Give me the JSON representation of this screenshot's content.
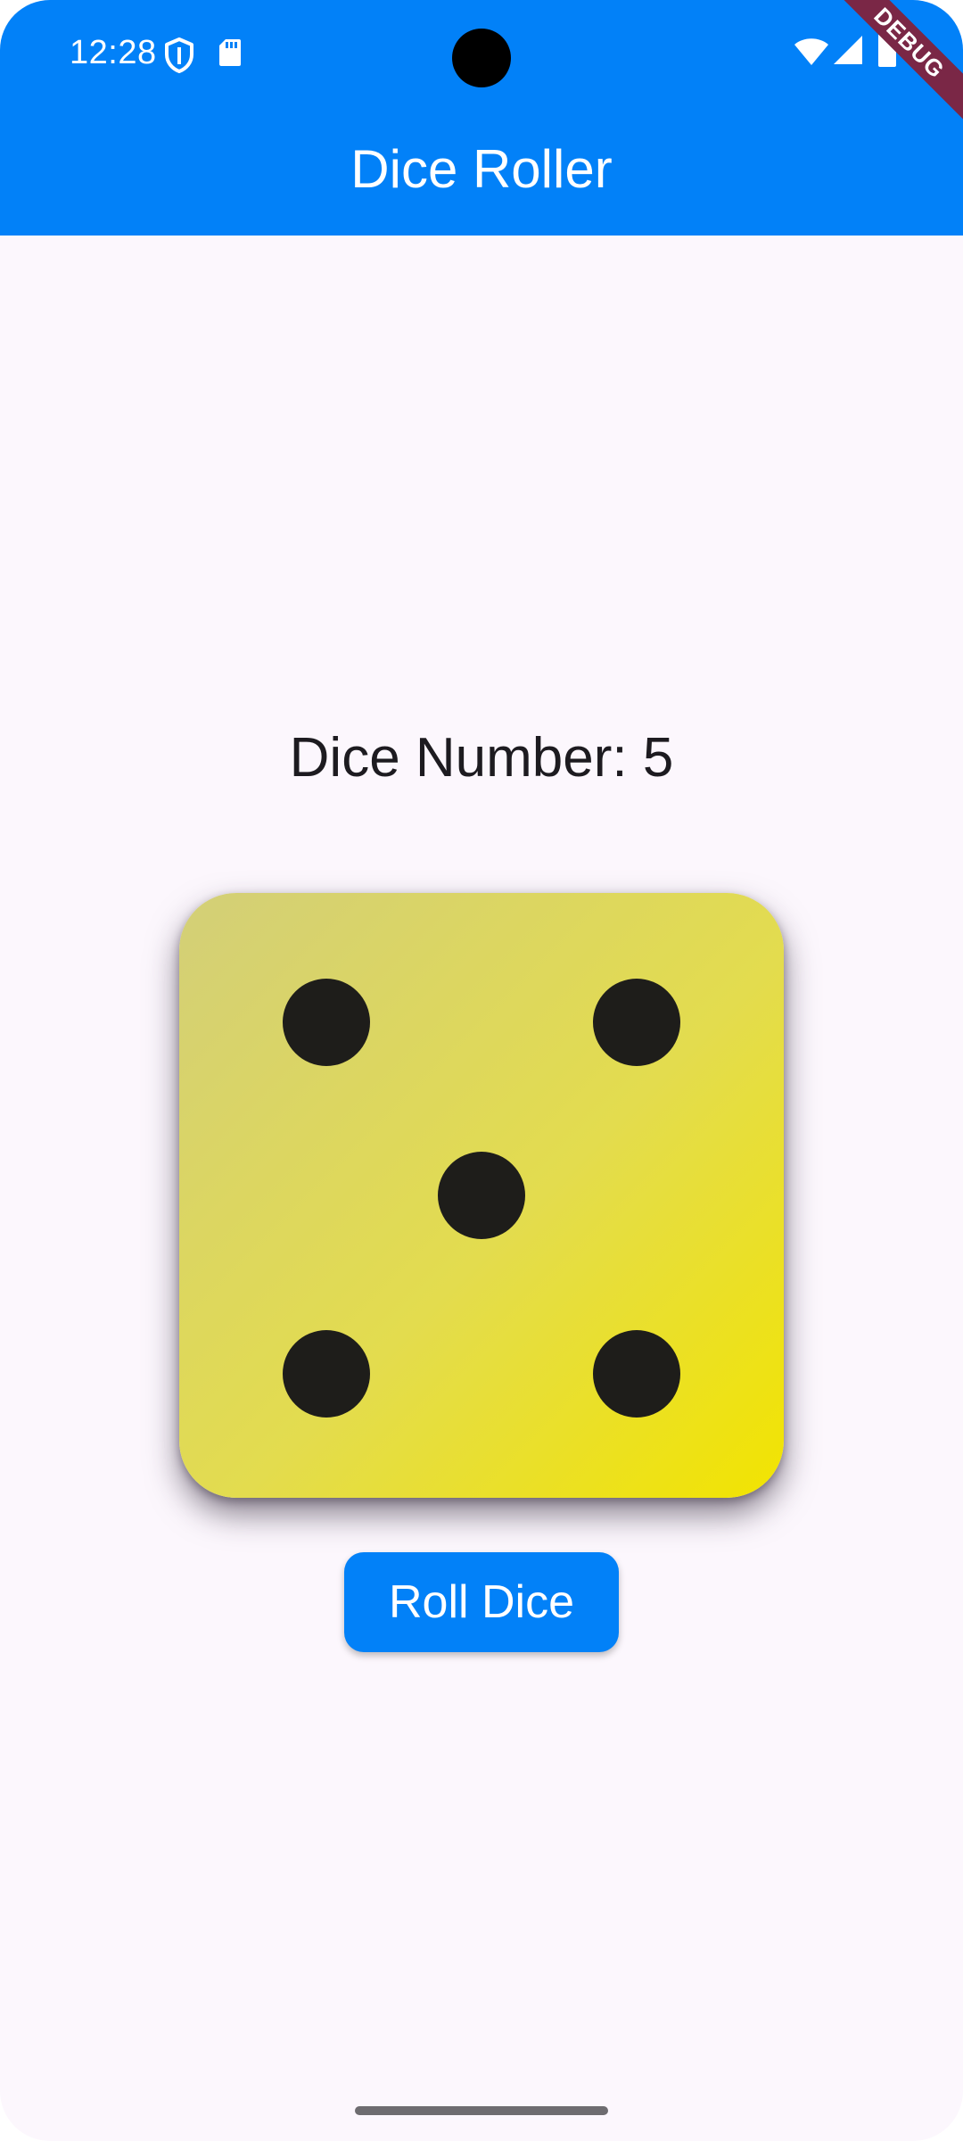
{
  "status_bar": {
    "time": "12:28",
    "left_icons": [
      "shield-icon",
      "sd-card-icon"
    ],
    "right_icons": [
      "wifi-icon",
      "cellular-signal-icon",
      "battery-icon"
    ],
    "debug_label": "DEBUG"
  },
  "app_bar": {
    "title": "Dice Roller",
    "color": "#0281f8"
  },
  "main": {
    "dice_number_text": "Dice Number: 5",
    "dice_value": 5,
    "die_gradient": [
      "#d3cf78",
      "#f2e400"
    ],
    "pip_color": "#1e1d1a",
    "roll_button_label": "Roll Dice"
  },
  "background_color": "#fcf7fd"
}
